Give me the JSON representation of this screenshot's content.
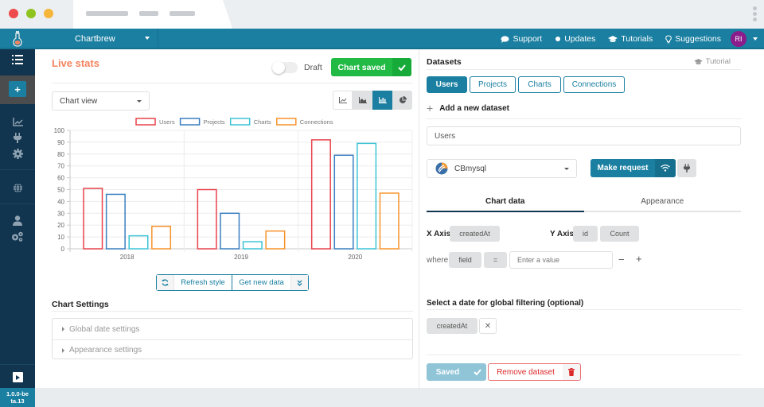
{
  "window": {
    "traffic_lights": [
      "#ee4b4b",
      "#8fc31f",
      "#f6b63c"
    ]
  },
  "topnav": {
    "brand": "Chartbrew",
    "items": [
      {
        "icon": "chat-bubble-icon",
        "label": "Support"
      },
      {
        "icon": "dot-icon",
        "label": "Updates"
      },
      {
        "icon": "graduation-cap-icon",
        "label": "Tutorials"
      },
      {
        "icon": "lightbulb-icon",
        "label": "Suggestions"
      }
    ],
    "avatar_initials": "RI",
    "colors": {
      "bar": "#1a7fa1",
      "avatar": "#8a1c8c"
    }
  },
  "sidebar": {
    "icons": [
      "list-icon",
      "add-icon",
      "chart-icon",
      "plug-icon",
      "gear-icon",
      "globe-icon",
      "user-icon",
      "cogs-icon",
      "play-icon"
    ],
    "version": "1.0.0-beta.13"
  },
  "chart_panel": {
    "title": "Live stats",
    "draft_label": "Draft",
    "draft_on": false,
    "saved_button": "Chart saved",
    "view_select": "Chart view",
    "chart_types": [
      "line-chart-icon",
      "area-chart-icon",
      "bar-chart-icon",
      "pie-chart-icon"
    ],
    "active_chart_type": "bar-chart-icon",
    "refresh_style": "Refresh style",
    "get_new_data": "Get new data",
    "settings_title": "Chart Settings",
    "settings_items": [
      "Global date settings",
      "Appearance settings"
    ]
  },
  "chart_data": {
    "type": "bar",
    "title": "",
    "xlabel": "",
    "ylabel": "",
    "categories": [
      "2018",
      "2019",
      "2020"
    ],
    "series": [
      {
        "name": "Users",
        "color": "#e8424c",
        "values": [
          51,
          50,
          92
        ]
      },
      {
        "name": "Projects",
        "color": "#3a7fc1",
        "values": [
          46,
          30,
          79
        ]
      },
      {
        "name": "Charts",
        "color": "#3cc4d6",
        "values": [
          11,
          6,
          89
        ]
      },
      {
        "name": "Connections",
        "color": "#f7922b",
        "values": [
          19,
          15,
          47
        ]
      }
    ],
    "ylim": [
      0,
      100
    ],
    "yticks": [
      0,
      10,
      20,
      30,
      40,
      50,
      60,
      70,
      80,
      90,
      100
    ],
    "grid": true,
    "legend": "top-center"
  },
  "datasets": {
    "title": "Datasets",
    "tutorial": "Tutorial",
    "tabs": [
      "Users",
      "Projects",
      "Charts",
      "Connections"
    ],
    "active_tab": "Users",
    "add_label": "Add a new dataset",
    "name_value": "Users",
    "connection": "CBmysql",
    "make_request": "Make request",
    "subtabs": [
      "Chart data",
      "Appearance"
    ],
    "active_subtab": "Chart data",
    "x_axis_label": "X Axis",
    "x_axis_value": "createdAt",
    "y_axis_label": "Y Axis",
    "y_axis_field": "id",
    "y_axis_op": "Count",
    "where_label": "where",
    "where_field": "field",
    "where_op": "=",
    "where_placeholder": "Enter a value",
    "date_filter_title": "Select a date for global filtering (optional)",
    "date_filter_value": "createdAt",
    "saved_button": "Saved",
    "remove_button": "Remove dataset"
  }
}
